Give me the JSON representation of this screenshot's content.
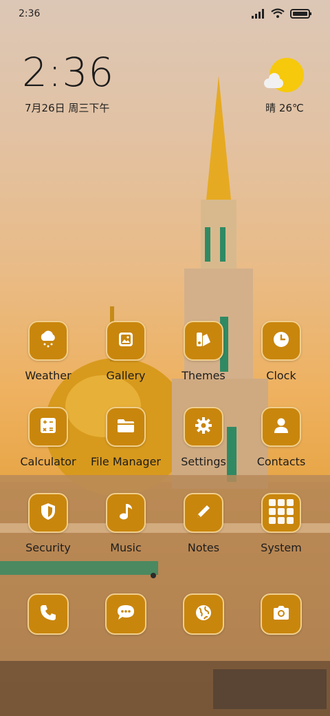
{
  "status_bar": {
    "time": "2:36"
  },
  "lockscreen": {
    "clock": "2:36",
    "date": "7月26日 周三下午",
    "weather": "晴 26℃"
  },
  "apps": [
    {
      "label": "Weather",
      "icon": "cloud-rain-icon"
    },
    {
      "label": "Gallery",
      "icon": "image-icon"
    },
    {
      "label": "Themes",
      "icon": "palette-icon"
    },
    {
      "label": "Clock",
      "icon": "clock-icon"
    },
    {
      "label": "Calculator",
      "icon": "calculator-icon"
    },
    {
      "label": "File Manager",
      "icon": "folder-icon"
    },
    {
      "label": "Settings",
      "icon": "gear-icon"
    },
    {
      "label": "Contacts",
      "icon": "person-icon"
    },
    {
      "label": "Security",
      "icon": "shield-icon"
    },
    {
      "label": "Music",
      "icon": "music-note-icon"
    },
    {
      "label": "Notes",
      "icon": "pencil-icon"
    },
    {
      "label": "System",
      "icon": "folder-grid-icon"
    }
  ],
  "dock": [
    {
      "icon": "phone-icon"
    },
    {
      "icon": "message-icon"
    },
    {
      "icon": "globe-icon"
    },
    {
      "icon": "camera-icon"
    }
  ],
  "colors": {
    "tile": "#c9860d",
    "tile_border": "#f1cf8c",
    "icon": "#ffffff"
  }
}
